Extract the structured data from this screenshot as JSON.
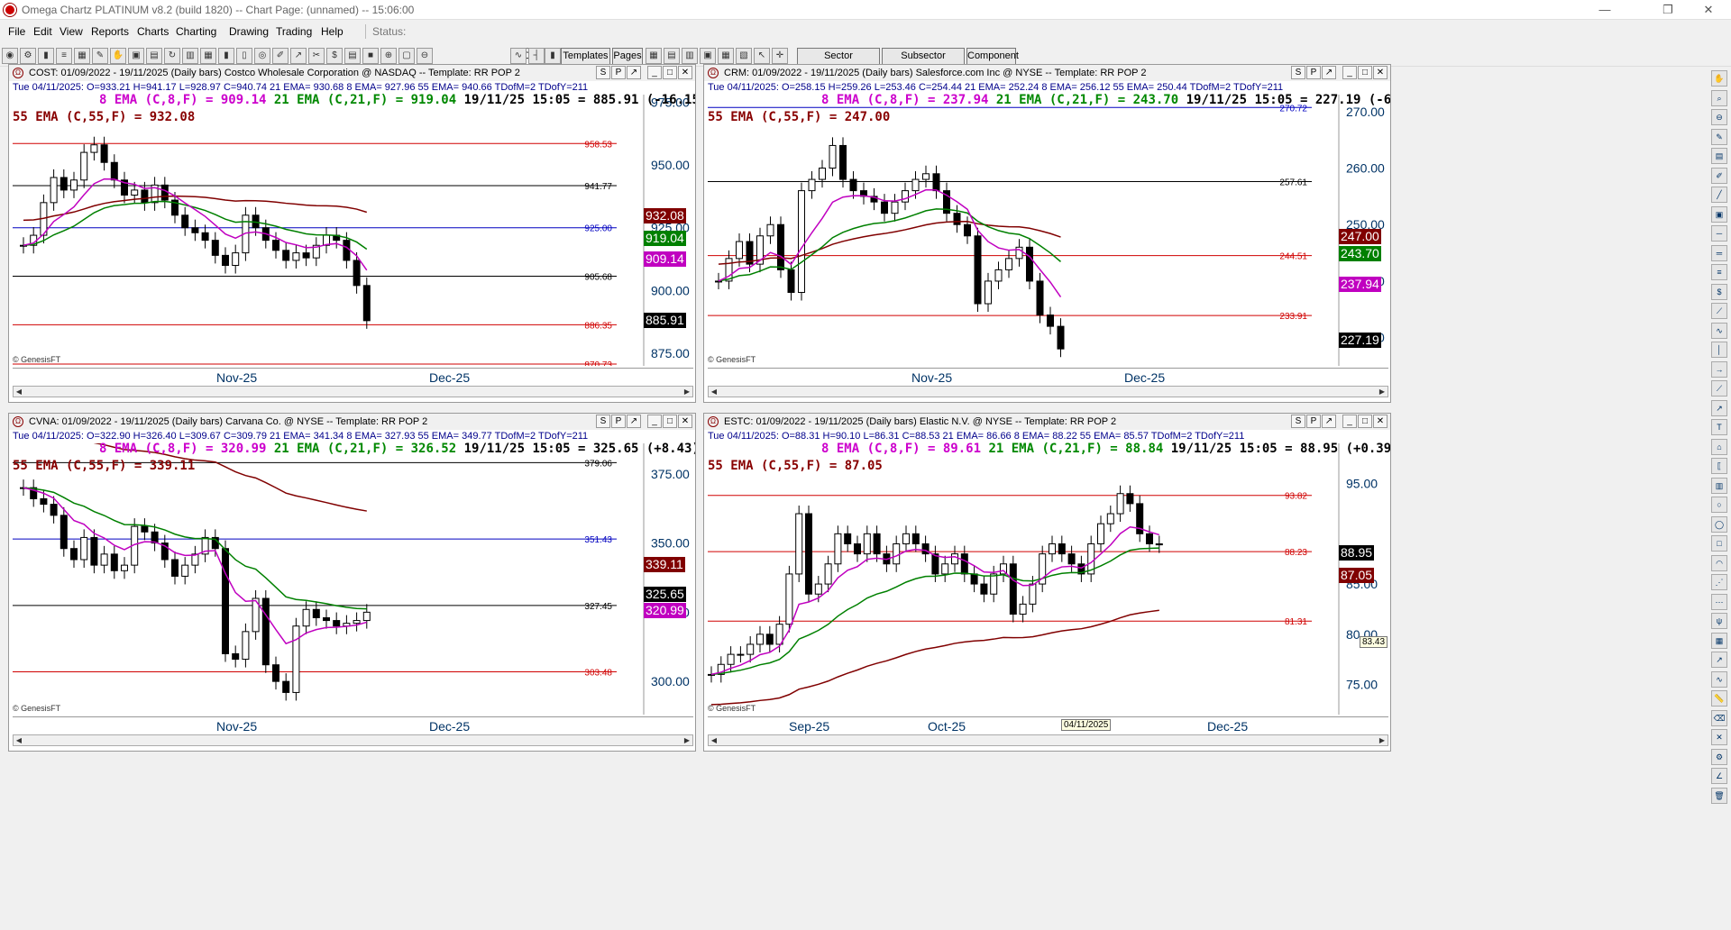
{
  "window": {
    "title": "Omega Chartz PLATINUM v8.2 (build 1820)  --  Chart Page: (unnamed)  --  15:06:00"
  },
  "menu": {
    "items": [
      "File",
      "Edit",
      "View",
      "Reports",
      "Charts",
      "Charting",
      "Drawing",
      "Trading",
      "Help"
    ],
    "status_label": "Status:"
  },
  "toolbar": {
    "period": "Daily",
    "templates": "Templates",
    "pages": "Pages",
    "sector": "Sector",
    "subsector": "Subsector",
    "component": "Component"
  },
  "panel_buttons": [
    "S",
    "P",
    "↗",
    "_",
    "□",
    "✕"
  ],
  "watermark": "© GenesisFT",
  "panels": [
    {
      "id": "cost",
      "header": "COST:  01/09/2022 - 19/11/2025  (Daily bars)   Costco Wholesale Corporation @ NASDAQ  --  Template: RR POP 2",
      "info": "Tue   04/11/2025:   O=933.21  H=941.17  L=928.97  C=940.74   21 EMA= 930.68   8 EMA= 927.96   55 EMA= 940.66   TDofM=2   TDofY=211",
      "ema8": "8 EMA (C,8,F) = 909.14",
      "ema21": "21 EMA (C,21,F) = 919.04",
      "last": "19/11/25 15:05 = 885.91 (-16.15)",
      "ema55": "55 EMA (C,55,F) = 932.08",
      "yaxis": [
        "975.00",
        "950.00",
        "925.00",
        "900.00",
        "875.00"
      ],
      "levels": [
        {
          "v": "958.53",
          "c": "#d00000"
        },
        {
          "v": "941.77",
          "c": "#000"
        },
        {
          "v": "925.00",
          "c": "#0000c0"
        },
        {
          "v": "905.68",
          "c": "#000"
        },
        {
          "v": "886.35",
          "c": "#d00000"
        },
        {
          "v": "870.73",
          "c": "#d00000"
        }
      ],
      "tags": [
        {
          "v": "932.08",
          "bg": "#800000"
        },
        {
          "v": "919.04",
          "bg": "#008000"
        },
        {
          "v": "909.14",
          "bg": "#c000c0"
        },
        {
          "v": "885.91",
          "bg": "#000"
        }
      ],
      "xlabels": [
        "Nov-25",
        "Dec-25"
      ]
    },
    {
      "id": "crm",
      "header": "CRM:  01/09/2022 - 19/11/2025  (Daily bars)   Salesforce.com Inc @ NYSE  --  Template: RR POP 2",
      "info": "Tue   04/11/2025:   O=258.15  H=259.26  L=253.46  C=254.44   21 EMA= 252.24   8 EMA= 256.12   55 EMA= 250.44   TDofM=2   TDofY=211",
      "ema8": "8 EMA (C,8,F) = 237.94",
      "ema21": "21 EMA (C,21,F) = 243.70",
      "last": "19/11/25 15:05 = 227.19 (-6.31)",
      "ema55": "55 EMA (C,55,F) = 247.00",
      "yaxis": [
        "270.00",
        "260.00",
        "250.00",
        "240.00",
        "230.00"
      ],
      "levels": [
        {
          "v": "270.72",
          "c": "#0000c0"
        },
        {
          "v": "257.61",
          "c": "#000"
        },
        {
          "v": "244.51",
          "c": "#d00000"
        },
        {
          "v": "233.91",
          "c": "#d00000"
        }
      ],
      "tags": [
        {
          "v": "247.00",
          "bg": "#800000"
        },
        {
          "v": "243.70",
          "bg": "#008000"
        },
        {
          "v": "237.94",
          "bg": "#c000c0"
        },
        {
          "v": "227.19",
          "bg": "#000"
        }
      ],
      "xlabels": [
        "Nov-25",
        "Dec-25"
      ]
    },
    {
      "id": "cvna",
      "header": "CVNA:  01/09/2022 - 19/11/2025  (Daily bars)   Carvana Co. @ NYSE  --  Template: RR POP 2",
      "info": "Tue   04/11/2025:   O=322.90  H=326.40  L=309.67  C=309.79   21 EMA= 341.34   8 EMA= 327.93   55 EMA= 349.77   TDofM=2   TDofY=211",
      "ema8": "8 EMA (C,8,F) = 320.99",
      "ema21": "21 EMA (C,21,F) = 326.52",
      "last": "19/11/25 15:05 = 325.65 (+8.43)",
      "ema55": "55 EMA (C,55,F) = 339.11",
      "yaxis": [
        "375.00",
        "350.00",
        "325.00",
        "300.00"
      ],
      "levels": [
        {
          "v": "379.06",
          "c": "#000"
        },
        {
          "v": "351.43",
          "c": "#0000c0"
        },
        {
          "v": "327.45",
          "c": "#000"
        },
        {
          "v": "303.48",
          "c": "#d00000"
        }
      ],
      "tags": [
        {
          "v": "339.11",
          "bg": "#800000"
        },
        {
          "v": "325.65",
          "bg": "#000"
        },
        {
          "v": "320.99",
          "bg": "#c000c0"
        }
      ],
      "xlabels": [
        "Nov-25",
        "Dec-25"
      ]
    },
    {
      "id": "estc",
      "header": "ESTC:  01/09/2022 - 19/11/2025  (Daily bars)   Elastic N.V. @ NYSE  --  Template: RR POP 2",
      "info": "Tue   04/11/2025:   O=88.31  H=90.10  L=86.31  C=88.53   21 EMA= 86.66   8 EMA= 88.22   55 EMA= 85.57   TDofM=2   TDofY=211",
      "ema8": "8 EMA (C,8,F) = 89.61",
      "ema21": "21 EMA (C,21,F) = 88.84",
      "last": "19/11/25 15:05 = 88.95 (+0.39)",
      "ema55": "55 EMA (C,55,F) = 87.05",
      "yaxis": [
        "95.00",
        "85.00",
        "80.00",
        "75.00"
      ],
      "levels": [
        {
          "v": "93.82",
          "c": "#d00000"
        },
        {
          "v": "88.23",
          "c": "#d00000"
        },
        {
          "v": "81.31",
          "c": "#d00000"
        }
      ],
      "tags": [
        {
          "v": "88.95",
          "bg": "#000"
        },
        {
          "v": "87.05",
          "bg": "#800000"
        }
      ],
      "cursor_value": "83.43",
      "date_tip": "04/11/2025",
      "xlabels": [
        "Sep-25",
        "Oct-25",
        "Dec-25"
      ]
    }
  ]
}
